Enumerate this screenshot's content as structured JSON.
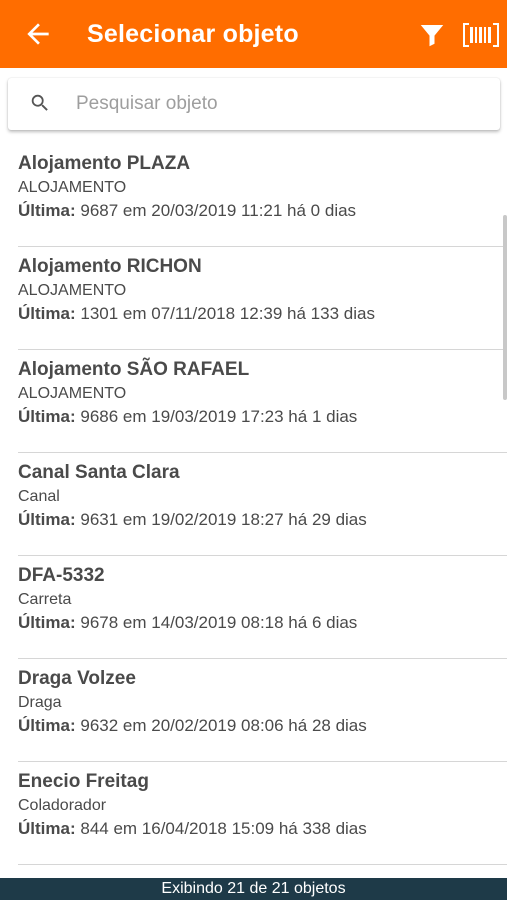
{
  "header": {
    "title": "Selecionar objeto",
    "back_icon": "arrow-back-icon",
    "filter_icon": "filter-icon",
    "barcode_icon": "barcode-icon",
    "color": "#ff6d00"
  },
  "search": {
    "placeholder": "Pesquisar objeto",
    "value": "",
    "icon": "search-icon"
  },
  "list": {
    "last_label": "Última:",
    "items": [
      {
        "name": "Alojamento PLAZA",
        "type": "ALOJAMENTO",
        "last": "9687 em 20/03/2019 11:21 há 0 dias"
      },
      {
        "name": "Alojamento RICHON",
        "type": "ALOJAMENTO",
        "last": "1301 em 07/11/2018 12:39 há 133 dias"
      },
      {
        "name": "Alojamento SÃO RAFAEL",
        "type": "ALOJAMENTO",
        "last": "9686 em 19/03/2019 17:23 há 1 dias"
      },
      {
        "name": "Canal Santa Clara",
        "type": "Canal",
        "last": "9631 em 19/02/2019 18:27 há 29 dias"
      },
      {
        "name": "DFA-5332",
        "type": "Carreta",
        "last": "9678 em 14/03/2019 08:18 há 6 dias"
      },
      {
        "name": "Draga Volzee",
        "type": "Draga",
        "last": "9632 em 20/02/2019 08:06 há 28 dias"
      },
      {
        "name": "Enecio Freitag",
        "type": "Coladorador",
        "last": "844 em 16/04/2018 15:09 há 338 dias"
      }
    ]
  },
  "footer": {
    "text": "Exibindo 21 de 21 objetos",
    "color": "#1e3a48"
  }
}
